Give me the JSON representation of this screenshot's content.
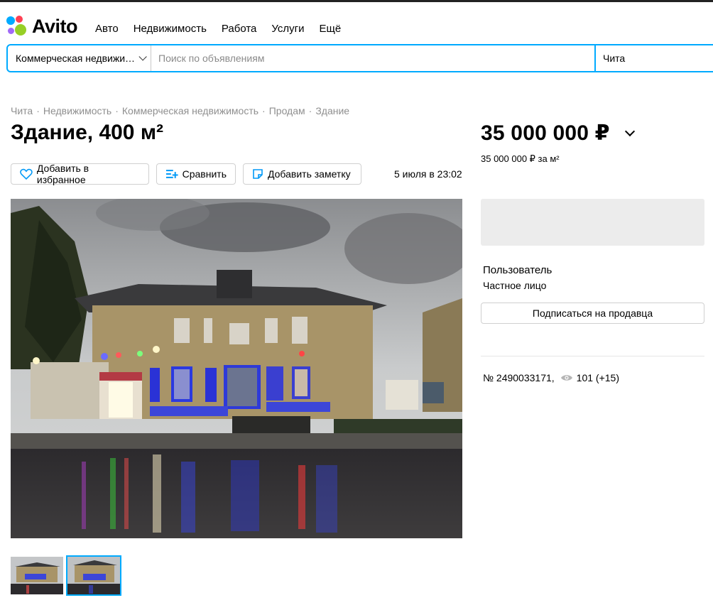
{
  "header": {
    "logo_text": "Avito",
    "nav": [
      "Авто",
      "Недвижимость",
      "Работа",
      "Услуги",
      "Ещё"
    ]
  },
  "search": {
    "category": "Коммерческая недвижи…",
    "placeholder": "Поиск по объявлениям",
    "city": "Чита"
  },
  "breadcrumbs": [
    "Чита",
    "Недвижимость",
    "Коммерческая недвижимость",
    "Продам",
    "Здание"
  ],
  "listing": {
    "title": "Здание, 400 м²",
    "favorite_label": "Добавить в избранное",
    "compare_label": "Сравнить",
    "note_label": "Добавить заметку",
    "date": "5 июля в 23:02",
    "photo_count": 2,
    "active_thumb": 2
  },
  "sidebar": {
    "price": "35 000 000 ₽",
    "price_per_m2": "35 000 000 ₽ за м²",
    "seller_name": "Пользователь",
    "seller_type": "Частное лицо",
    "subscribe_label": "Подписаться на продавца",
    "ad_number": "№ 2490033171,",
    "views": "101 (+15)"
  },
  "colors": {
    "accent": "#00aaff",
    "logo_dots": [
      "#ff4053",
      "#00aaff",
      "#97cf26",
      "#a169f7"
    ]
  },
  "icons": [
    "heart-icon",
    "compare-icon",
    "note-icon",
    "eye-icon",
    "chevron-down-icon"
  ]
}
